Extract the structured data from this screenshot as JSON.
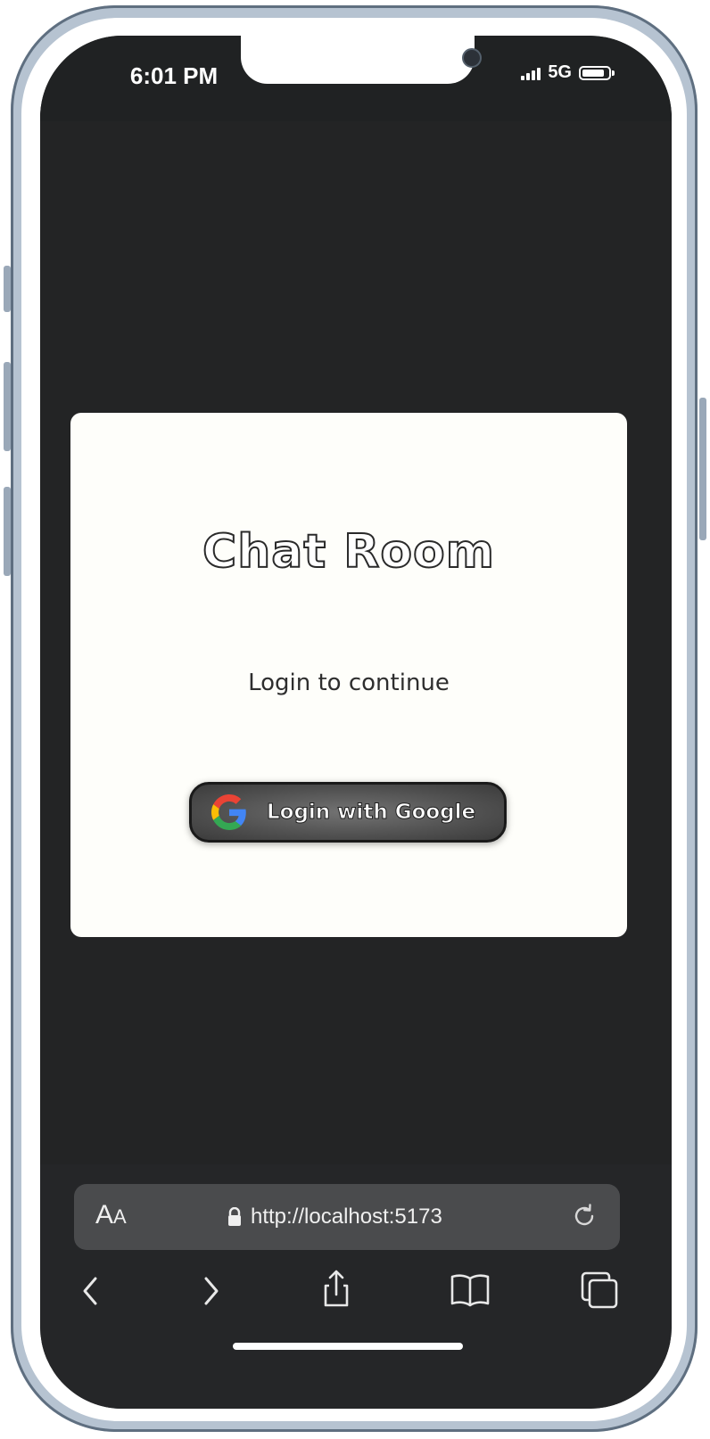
{
  "status_bar": {
    "time": "6:01 PM",
    "network": "5G",
    "icons": [
      "signal-icon",
      "battery-icon"
    ]
  },
  "login_card": {
    "title": "Chat Room",
    "subtitle": "Login to continue",
    "google_button_label": "Login with Google",
    "google_icon": "google-icon"
  },
  "browser": {
    "text_size_label": "A",
    "text_size_label_small": "A",
    "url": "http://localhost:5173",
    "icons": [
      "lock-icon",
      "reload-icon",
      "back-icon",
      "forward-icon",
      "share-icon",
      "bookmarks-icon",
      "tabs-icon"
    ]
  },
  "colors": {
    "page_background": "#232425",
    "card_background": "#fefefa",
    "button_background": "#5a5a5a",
    "address_bar": "#4a4b4d"
  }
}
